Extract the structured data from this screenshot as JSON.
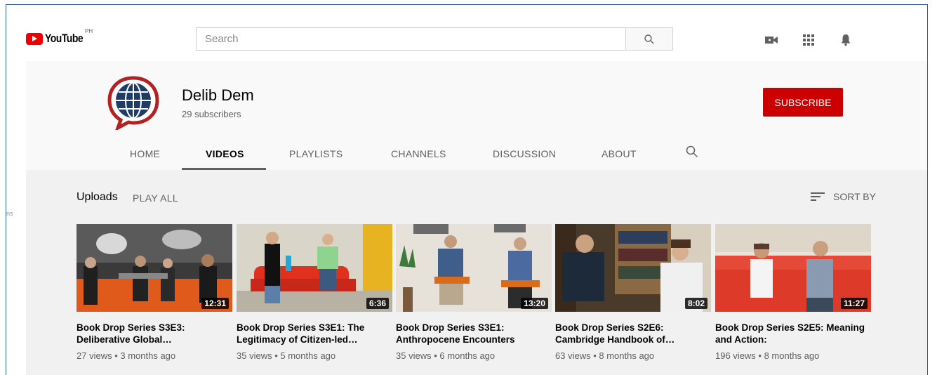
{
  "masthead": {
    "logo_text": "YouTube",
    "logo_country": "PH",
    "search_placeholder": "Search",
    "icons": [
      "video-camera-icon",
      "apps-grid-icon",
      "bell-icon"
    ]
  },
  "side_fragment": "ns",
  "channel": {
    "name": "Delib Dem",
    "subscribers": "29 subscribers",
    "subscribe_label": "SUBSCRIBE",
    "colors": {
      "subscribe": "#cc0000",
      "avatar_ring": "#b22222",
      "globe": "#1f3c68"
    }
  },
  "tabs": [
    {
      "label": "HOME",
      "active": false
    },
    {
      "label": "VIDEOS",
      "active": true
    },
    {
      "label": "PLAYLISTS",
      "active": false
    },
    {
      "label": "CHANNELS",
      "active": false
    },
    {
      "label": "DISCUSSION",
      "active": false
    },
    {
      "label": "ABOUT",
      "active": false
    }
  ],
  "section": {
    "title": "Uploads",
    "play_all": "PLAY ALL",
    "sort_by": "SORT BY"
  },
  "videos": [
    {
      "title": "Book Drop Series S3E3: Deliberative Global…",
      "duration": "12:31",
      "views": "27 views",
      "age": "3 months ago",
      "meta": "27 views • 3 months ago"
    },
    {
      "title": "Book Drop Series S3E1: The Legitimacy of Citizen-led…",
      "duration": "6:36",
      "views": "35 views",
      "age": "5 months ago",
      "meta": "35 views • 5 months ago"
    },
    {
      "title": "Book Drop Series S3E1: Anthropocene Encounters",
      "duration": "13:20",
      "views": "35 views",
      "age": "6 months ago",
      "meta": "35 views • 6 months ago"
    },
    {
      "title": "Book Drop Series S2E6: Cambridge Handbook of…",
      "duration": "8:02",
      "views": "63 views",
      "age": "8 months ago",
      "meta": "63 views • 8 months ago"
    },
    {
      "title": "Book Drop Series S2E5: Meaning and Action:",
      "duration": "11:27",
      "views": "196 views",
      "age": "8 months ago",
      "meta": "196 views • 8 months ago"
    }
  ]
}
